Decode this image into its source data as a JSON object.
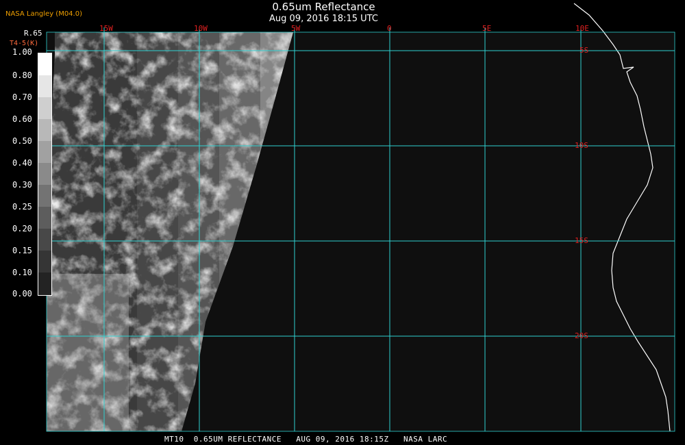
{
  "title": "0.65um Reflectance",
  "subtitle": "Aug 09, 2016 18:15 UTC",
  "organization": "NASA Langley (M04.0)",
  "legend": {
    "title": "R.65",
    "subtitle": "T4-5(K)",
    "labels": [
      "1.00",
      "0.80",
      "0.70",
      "0.60",
      "0.50",
      "0.40",
      "0.30",
      "0.25",
      "0.20",
      "0.15",
      "0.10",
      "0.00"
    ]
  },
  "longitude_labels": [
    "15W",
    "10W",
    "5W",
    "0",
    "5E",
    "10E"
  ],
  "latitude_labels": [
    "5S",
    "10S",
    "15S",
    "20S"
  ],
  "caption": "MT10  0.65UM REFLECTANCE   AUG 09, 2016 18:15Z   NASA LARC",
  "colors": {
    "grid": "#2fd2d2",
    "labels": "#e02020",
    "coastline": "#ffffff",
    "background": "#0f0f0f"
  }
}
